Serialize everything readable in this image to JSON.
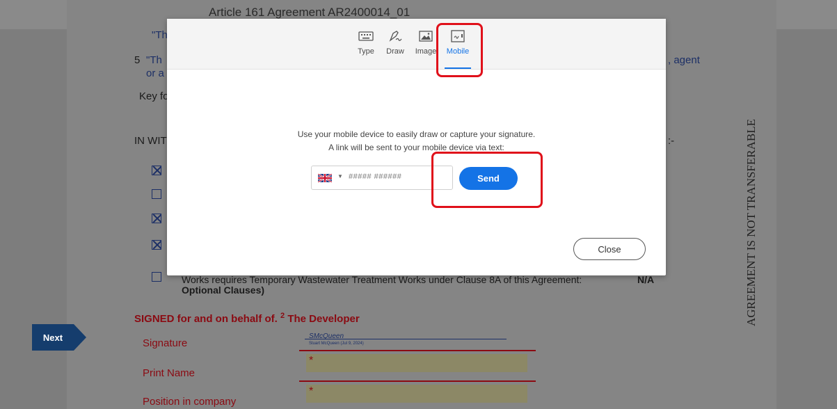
{
  "document": {
    "header_title": "Article 161 Agreement AR2400014_01",
    "clause_fragment": "\"Th",
    "clause_number": "5",
    "clause_start": "\"Th",
    "clause_line2": "or a",
    "clause_end": ", agent",
    "key_fragment": "Key fo",
    "in_witness": "IN WIT",
    "in_witness_end": ":-",
    "temporary_works_text": "Works requires Temporary Wastewater Treatment Works under Clause 8A of this Agreement:",
    "temporary_works_value": "N/A",
    "optional_clauses": "Optional Clauses)",
    "signed_text": "SIGNED for and on behalf of.",
    "signed_superscript": "2",
    "signed_party": "The Developer",
    "signature_label": "Signature",
    "print_name_label": "Print Name",
    "position_label": "Position in company",
    "required_marker": "*",
    "signature_scribble": "SMcQueen",
    "signature_caption": "Stuart McQueen (Jul 9, 2024)",
    "vertical_notice": "AGREEMENT IS NOT TRANSFERABLE",
    "next_button": "Next"
  },
  "modal": {
    "tabs": [
      {
        "label": "Type",
        "icon": "keyboard-icon"
      },
      {
        "label": "Draw",
        "icon": "pen-icon"
      },
      {
        "label": "Image",
        "icon": "image-icon"
      },
      {
        "label": "Mobile",
        "icon": "mobile-icon",
        "active": true
      }
    ],
    "message_line1": "Use your mobile device to easily draw or capture your signature.",
    "message_line2": "A link will be sent to your mobile device via text:",
    "phone_placeholder": "##### ######",
    "country": "uk-flag-icon",
    "send_label": "Send",
    "close_label": "Close"
  },
  "colors": {
    "accent": "#1473e6",
    "highlight": "#e0101a",
    "doc_red": "#8b0a12",
    "next_button": "#153d6d"
  }
}
